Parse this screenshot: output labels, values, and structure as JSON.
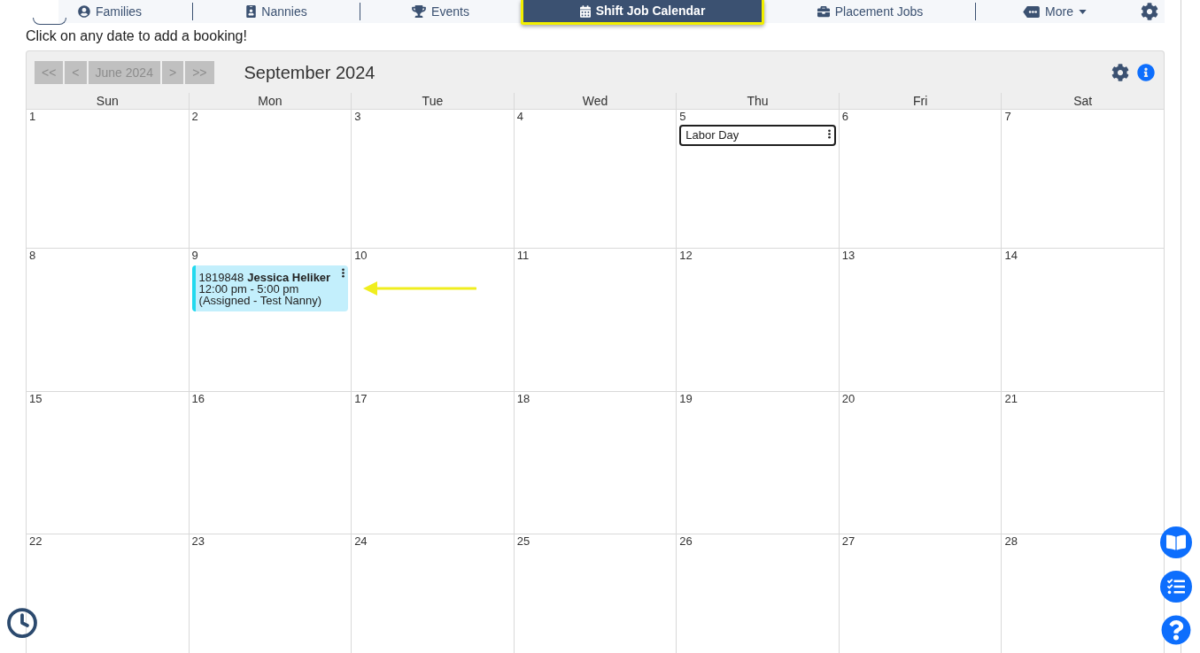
{
  "nav": {
    "items": [
      {
        "label": "Families",
        "selected": false,
        "dropdown": false
      },
      {
        "label": "Nannies",
        "selected": false,
        "dropdown": false
      },
      {
        "label": "Events",
        "selected": false,
        "dropdown": false
      },
      {
        "label": "Shift Job Calendar",
        "selected": true,
        "dropdown": false
      },
      {
        "label": "Placement Jobs",
        "selected": false,
        "dropdown": false
      },
      {
        "label": "More",
        "selected": false,
        "dropdown": true
      }
    ]
  },
  "instruction": "Click on any date to add a booking!",
  "calendar": {
    "nav_buttons": [
      {
        "label": "<<",
        "disabled": true
      },
      {
        "label": "<",
        "disabled": true
      },
      {
        "label": "June 2024",
        "disabled": true
      },
      {
        "label": ">",
        "disabled": true
      },
      {
        "label": ">>",
        "disabled": true
      }
    ],
    "title": "September 2024",
    "weekdays": [
      "Sun",
      "Mon",
      "Tue",
      "Wed",
      "Thu",
      "Fri",
      "Sat"
    ],
    "weeks": [
      [
        {
          "day": "1"
        },
        {
          "day": "2"
        },
        {
          "day": "3"
        },
        {
          "day": "4"
        },
        {
          "day": "5",
          "events": [
            {
              "kind": "holiday",
              "title": "Labor Day"
            }
          ]
        },
        {
          "day": "6"
        },
        {
          "day": "7"
        }
      ],
      [
        {
          "day": "8"
        },
        {
          "day": "9",
          "events": [
            {
              "kind": "shift",
              "job_number": "1819848",
              "name": "Jessica Heliker",
              "time": "12:00 pm - 5:00 pm",
              "status": "(Assigned - Test Nanny)"
            }
          ]
        },
        {
          "day": "10"
        },
        {
          "day": "11"
        },
        {
          "day": "12"
        },
        {
          "day": "13"
        },
        {
          "day": "14"
        }
      ],
      [
        {
          "day": "15"
        },
        {
          "day": "16"
        },
        {
          "day": "17"
        },
        {
          "day": "18"
        },
        {
          "day": "19"
        },
        {
          "day": "20"
        },
        {
          "day": "21"
        }
      ],
      [
        {
          "day": "22"
        },
        {
          "day": "23"
        },
        {
          "day": "24"
        },
        {
          "day": "25"
        },
        {
          "day": "26"
        },
        {
          "day": "27"
        },
        {
          "day": "28"
        }
      ]
    ]
  }
}
